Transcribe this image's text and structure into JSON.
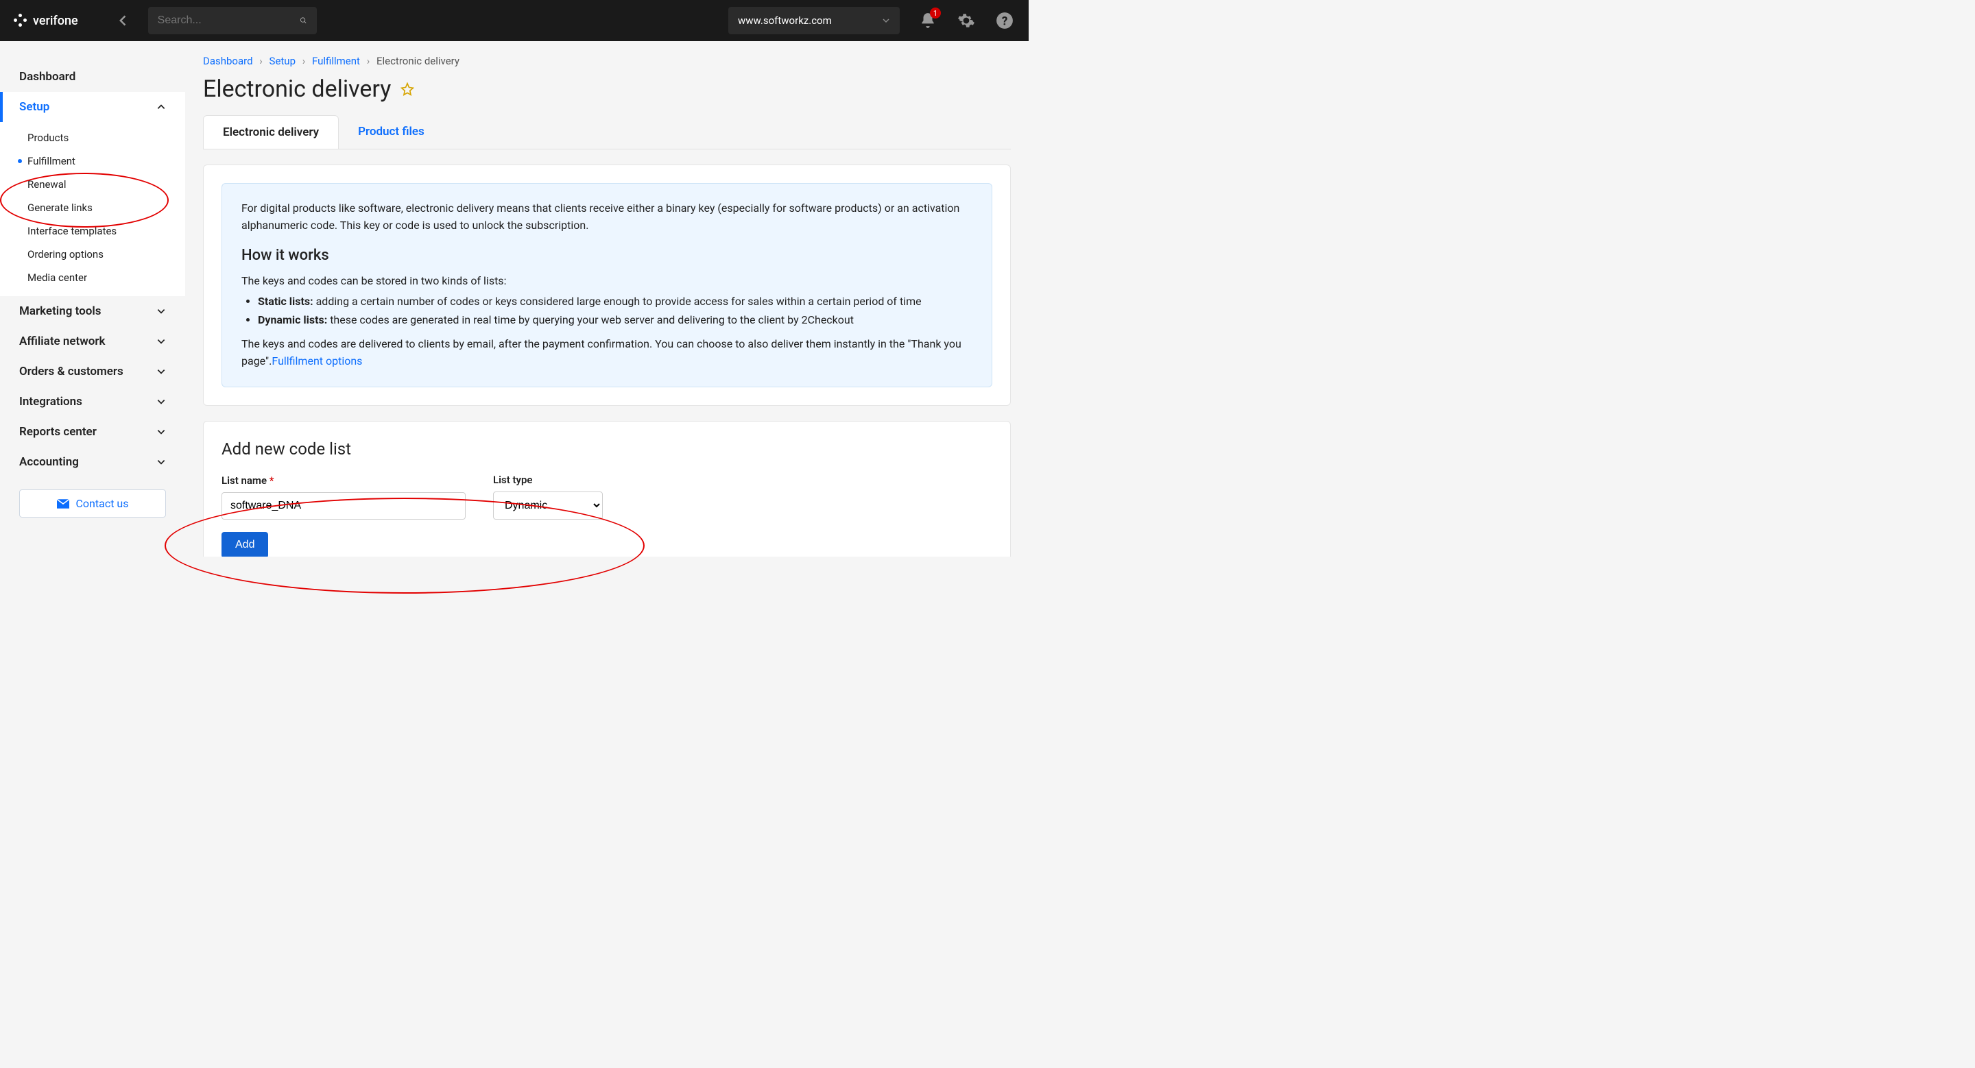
{
  "top": {
    "brand": "verifone",
    "search_placeholder": "Search...",
    "domain": "www.softworkz.com",
    "notif_count": "1"
  },
  "sidebar": {
    "dashboard": "Dashboard",
    "setup": "Setup",
    "setup_children": {
      "products": "Products",
      "fulfillment": "Fulfillment",
      "renewal": "Renewal",
      "generate_links": "Generate links",
      "interface_templates": "Interface templates",
      "ordering_options": "Ordering options",
      "media_center": "Media center"
    },
    "marketing": "Marketing tools",
    "affiliate": "Affiliate network",
    "orders": "Orders & customers",
    "integrations": "Integrations",
    "reports": "Reports center",
    "accounting": "Accounting",
    "contact": "Contact us"
  },
  "breadcrumb": {
    "0": "Dashboard",
    "1": "Setup",
    "2": "Fulfillment",
    "3": "Electronic delivery"
  },
  "page": {
    "title": "Electronic delivery"
  },
  "tabs": {
    "ed": "Electronic delivery",
    "pf": "Product files"
  },
  "info": {
    "intro": "For digital products like software, electronic delivery means that clients receive either a binary key (especially for software products) or an activation alphanumeric code. This key or code is used to unlock the subscription.",
    "how_title": "How it works",
    "lists_intro": "The keys and codes can be stored in two kinds of lists:",
    "static_label": "Static lists:",
    "static_text": " adding a certain number of codes or keys considered large enough to provide access for sales within a certain period of time",
    "dynamic_label": "Dynamic lists:",
    "dynamic_text": " these codes are generated in real time by querying your web server and delivering to the client by 2Checkout",
    "delivery_text": "The keys and codes are delivered to clients by email, after the payment confirmation. You can choose to also deliver them instantly in the \"Thank you page\".",
    "link": "Fullfilment options"
  },
  "form": {
    "title": "Add new code list",
    "name_label": "List name",
    "type_label": "List type",
    "name_value": "software_DNA",
    "type_value": "Dynamic",
    "add": "Add"
  }
}
